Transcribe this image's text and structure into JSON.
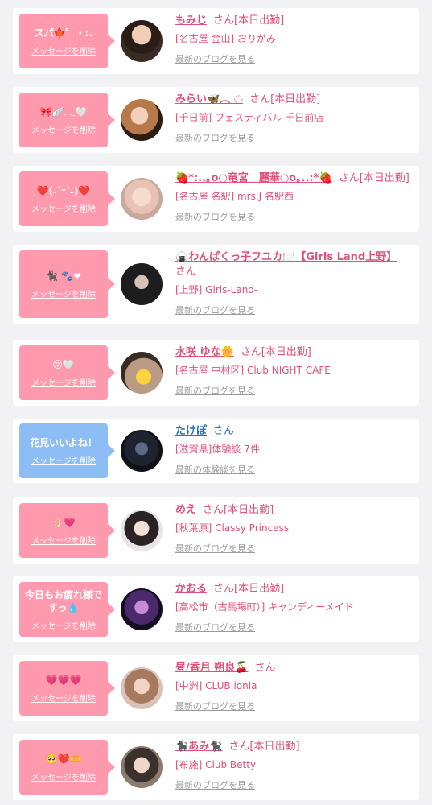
{
  "colors": {
    "pink": "#ff9aae",
    "blue": "#8cbef5",
    "text_pink": "#e0507a"
  },
  "cards": [
    {
      "message": "スパ🍁゜・:.",
      "delete": "メッセージを削除",
      "name": "もみじ",
      "san": "さん",
      "status": "[本日出勤]",
      "shop": "[名古屋 金山] おりがみ",
      "link": "最新のブログを見る",
      "bubble": "pink"
    },
    {
      "message": "🎀🪽𓂃🤍",
      "delete": "メッセージを削除",
      "name": "みらい🦋︵ ◌",
      "san": "さん",
      "status": "[本日出勤]",
      "shop": "[千日前] フェスティバル 千日前店",
      "link": "最新のブログを見る",
      "bubble": "pink"
    },
    {
      "message": "❤️(˶˙ᵕ˙˶)❤️",
      "delete": "メッセージを削除",
      "name": "🍓*:..｡o○竜宮　麗華○o｡..:*🍓",
      "san": "さん",
      "status": "[本日出勤]",
      "shop": "[名古屋 名駅] mrs.J 名駅西",
      "link": "最新のブログを見る",
      "bubble": "pink"
    },
    {
      "message": "🐈‍⬛ 🐾❤",
      "delete": "メッセージを削除",
      "name": "🍙わんぱくっ子フユカ🍽️【Girls Land上野】",
      "san": "さん",
      "status": "",
      "shop": "[上野] Girls-Land-",
      "link": "最新のブログを見る",
      "bubble": "pink"
    },
    {
      "message": "😚🤍",
      "delete": "メッセージを削除",
      "name": "水咲 ゆな🌼",
      "san": "さん",
      "status": "[本日出勤]",
      "shop": "[名古屋 中村区] Club NIGHT CAFE",
      "link": "最新のブログを見る",
      "bubble": "pink"
    },
    {
      "message": "花見いいよね！",
      "delete": "メッセージを削除",
      "name": "たけぽ",
      "san": "さん",
      "status": "",
      "shop": "[滋賀県]体験談 7件",
      "link": "最新の体験談を見る",
      "bubble": "blue"
    },
    {
      "message": "👌🏻💗",
      "delete": "メッセージを削除",
      "name": "めえ",
      "san": "さん",
      "status": "[本日出勤]",
      "shop": "[秋葉原] Classy Princess",
      "link": "最新のブログを見る",
      "bubble": "pink"
    },
    {
      "message": "今日もお疲れ様ですっ💧",
      "delete": "メッセージを削除",
      "name": "かおる",
      "san": "さん",
      "status": "[本日出勤]",
      "shop": "[高松市（古馬場町）] キャンディーメイド",
      "link": "最新のブログを見る",
      "bubble": "pink"
    },
    {
      "message": "💗💗💗",
      "delete": "メッセージを削除",
      "name": "昼/香月 朔良🍒",
      "san": "さん",
      "status": "",
      "shop": "[中洲] CLUB ionia",
      "link": "最新のブログを見る",
      "bubble": "pink"
    },
    {
      "message": "🥺❤️🫶",
      "delete": "メッセージを削除",
      "name": "🐈‍⬛あみ🐈‍⬛",
      "san": "さん",
      "status": "[本日出勤]",
      "shop": "[布施] Club Betty",
      "link": "最新のブログを見る",
      "bubble": "pink"
    }
  ]
}
